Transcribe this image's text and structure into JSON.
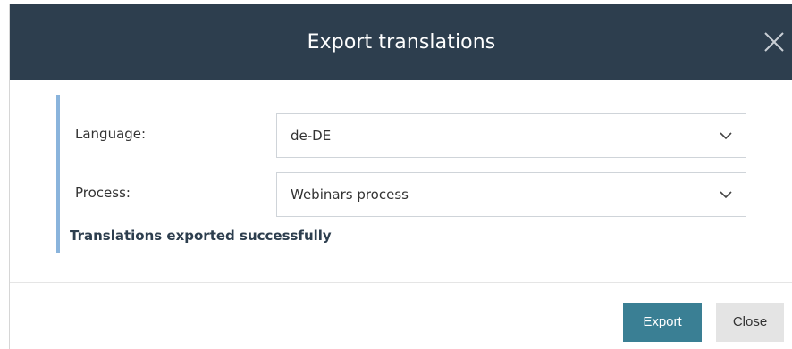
{
  "dialog": {
    "title": "Export translations",
    "close_icon": "close-icon"
  },
  "form": {
    "language": {
      "label": "Language:",
      "value": "de-DE",
      "icon": "chevron-down-icon"
    },
    "process": {
      "label": "Process:",
      "value": "Webinars process",
      "icon": "chevron-down-icon"
    },
    "message": "Translations exported successfully"
  },
  "footer": {
    "export_label": "Export",
    "close_label": "Close"
  },
  "colors": {
    "header_bg": "#2d3e4e",
    "accent_border": "#8ab4dc",
    "primary_button": "#3a7f94",
    "secondary_button": "#e4e4e4"
  }
}
